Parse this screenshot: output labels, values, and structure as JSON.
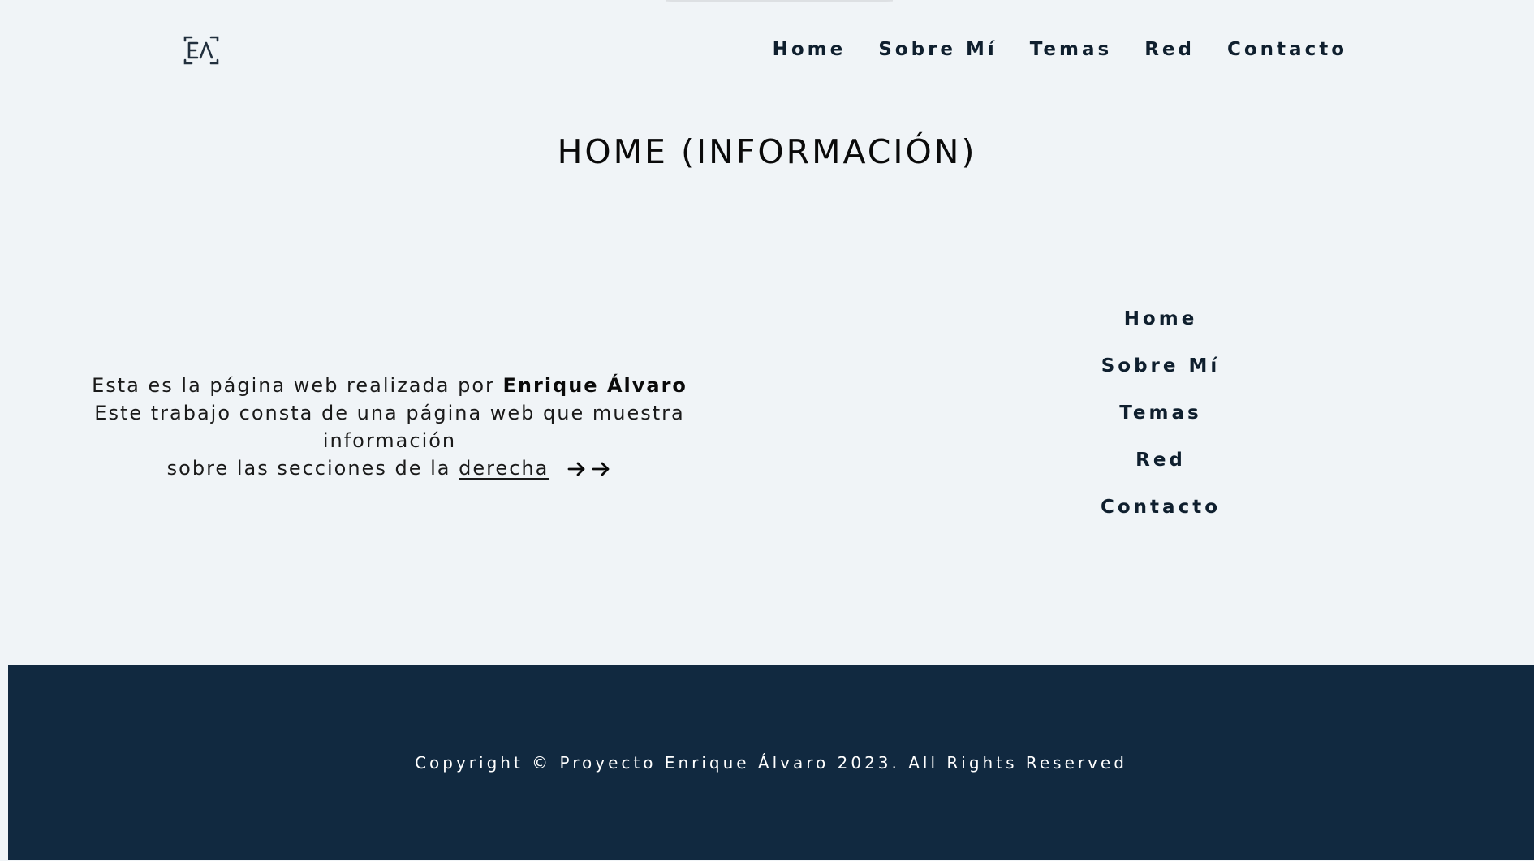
{
  "brand": {
    "logo_text": "EA",
    "icon": "ea-monogram-logo"
  },
  "topnav": {
    "items": [
      {
        "label": "Home"
      },
      {
        "label": "Sobre Mí"
      },
      {
        "label": "Temas"
      },
      {
        "label": "Red"
      },
      {
        "label": "Contacto"
      }
    ]
  },
  "main": {
    "title": "HOME (INFORMACIÓN)",
    "intro": {
      "line1_prefix": "Esta es la página web realizada por ",
      "line1_name": "Enrique Álvaro",
      "line2": "Este trabajo consta de una página web que muestra información",
      "line3_prefix": "sobre las secciones de la ",
      "line3_link": "derecha",
      "arrow_icon": "arrow-right-icon"
    }
  },
  "sidenav": {
    "items": [
      {
        "label": "Home"
      },
      {
        "label": "Sobre Mí"
      },
      {
        "label": "Temas"
      },
      {
        "label": "Red"
      },
      {
        "label": "Contacto"
      }
    ]
  },
  "footer": {
    "copyright": "Copyright © Proyecto Enrique Álvaro 2023. All Rights Reserved"
  },
  "colors": {
    "background": "#f0f4f7",
    "text_dark": "#0f1f2e",
    "footer_bg": "#112940",
    "footer_text": "#ffffff"
  }
}
